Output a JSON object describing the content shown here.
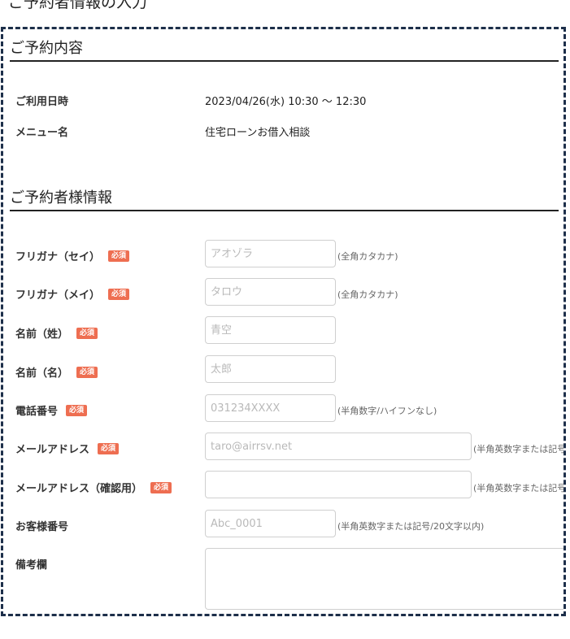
{
  "page": {
    "heading": "ご予約者情報の入力"
  },
  "reservation": {
    "title": "ご予約内容",
    "rows": [
      {
        "label": "ご利用日時",
        "value": "2023/04/26(水) 10:30 〜 12:30"
      },
      {
        "label": "メニュー名",
        "value": "住宅ローンお借入相談"
      }
    ]
  },
  "customer": {
    "title": "ご予約者様情報",
    "required_badge": "必須",
    "fields": [
      {
        "label": "フリガナ（セイ）",
        "required": true,
        "placeholder": "アオゾラ",
        "hint": "(全角カタカナ)"
      },
      {
        "label": "フリガナ（メイ）",
        "required": true,
        "placeholder": "タロウ",
        "hint": "(全角カタカナ)"
      },
      {
        "label": "名前（姓）",
        "required": true,
        "placeholder": "青空",
        "hint": ""
      },
      {
        "label": "名前（名）",
        "required": true,
        "placeholder": "太郎",
        "hint": ""
      },
      {
        "label": "電話番号",
        "required": true,
        "placeholder": "031234XXXX",
        "hint": "(半角数字/ハイフンなし)"
      },
      {
        "label": "メールアドレス",
        "required": true,
        "placeholder": "taro@airrsv.net",
        "hint": "(半角英数字または記号"
      },
      {
        "label": "メールアドレス（確認用）",
        "required": true,
        "placeholder": "",
        "hint": "(半角英数字または記号"
      },
      {
        "label": "お客様番号",
        "required": false,
        "placeholder": "Abc_0001",
        "hint": "(半角英数字または記号/20文字以内)"
      },
      {
        "label": "備考欄",
        "required": false,
        "placeholder": "",
        "hint": ""
      }
    ]
  }
}
